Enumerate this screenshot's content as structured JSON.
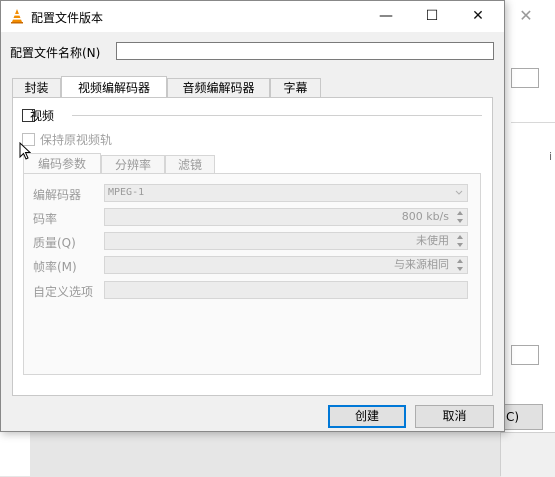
{
  "window": {
    "title": "配置文件版本",
    "controls": {
      "minimize": "—",
      "maximize": "☐",
      "close": "✕"
    }
  },
  "profile_name": {
    "label": "配置文件名称(N)",
    "value": ""
  },
  "tabs": [
    {
      "label": "封装",
      "active": false
    },
    {
      "label": "视频编解码器",
      "active": true
    },
    {
      "label": "音频编解码器",
      "active": false
    },
    {
      "label": "字幕",
      "active": false
    }
  ],
  "video": {
    "group_label": "视频",
    "checked": false,
    "keep_original_label": "保持原视频轨",
    "inner_tabs": [
      {
        "label": "编码参数",
        "active": true
      },
      {
        "label": "分辨率",
        "active": false
      },
      {
        "label": "滤镜",
        "active": false
      }
    ],
    "fields": {
      "codec": {
        "label": "编解码器",
        "value": "MPEG-1"
      },
      "bitrate": {
        "label": "码率",
        "value": "800 kb/s"
      },
      "quality": {
        "label": "质量(Q)",
        "value": "未使用"
      },
      "framerate": {
        "label": "帧率(M)",
        "value": "与来源相同"
      },
      "custom": {
        "label": "自定义选项",
        "value": ""
      }
    }
  },
  "buttons": {
    "create": "创建",
    "cancel": "取消"
  },
  "background_window": {
    "close": "✕",
    "glyph": "i",
    "button_fragment": "C)"
  },
  "colors": {
    "accent": "#0078d7",
    "icon_orange": "#f28c00"
  }
}
